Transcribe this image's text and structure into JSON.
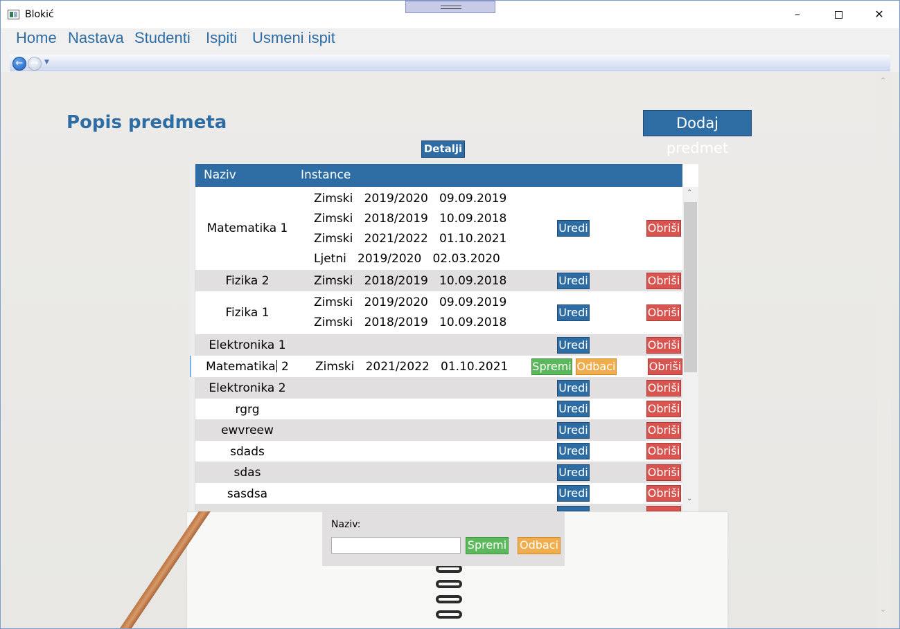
{
  "window": {
    "title": "Blokić"
  },
  "menu": [
    "Home",
    "Nastava",
    "Studenti",
    "Ispiti",
    "Usmeni ispit"
  ],
  "page": {
    "title": "Popis predmeta",
    "add_button": "Dodaj predmet",
    "details_button": "Detalji"
  },
  "table": {
    "headers": {
      "name": "Naziv",
      "instances": "Instance"
    },
    "edit_label": "Uredi",
    "delete_label": "Obriši",
    "save_label": "Spremi",
    "cancel_label": "Odbaci",
    "rows": [
      {
        "name": "Matematika 1",
        "instances": [
          "Zimski   2019/2020   09.09.2019",
          "Zimski   2018/2019   10.09.2018",
          "Zimski   2021/2022   01.10.2021",
          "Ljetni   2019/2020   02.03.2020"
        ]
      },
      {
        "name": "Fizika 2",
        "instances": [
          "Zimski   2018/2019   10.09.2018"
        ]
      },
      {
        "name": "Fizika 1",
        "instances": [
          "Zimski   2019/2020   09.09.2019",
          "Zimski   2018/2019   10.09.2018"
        ]
      },
      {
        "name": "Elektronika 1",
        "instances": []
      },
      {
        "name_before_caret": "Matematika",
        "name_after_caret": " 2",
        "instances": [
          "Zimski   2021/2022   01.10.2021"
        ],
        "editing": true
      },
      {
        "name": "Elektronika 2",
        "instances": []
      },
      {
        "name": "rgrg",
        "instances": []
      },
      {
        "name": "ewvreew",
        "instances": []
      },
      {
        "name": "sdads",
        "instances": []
      },
      {
        "name": "sdas",
        "instances": []
      },
      {
        "name": "sasdsa",
        "instances": []
      }
    ]
  },
  "form": {
    "label": "Naziv:",
    "value": "",
    "save_label": "Spremi",
    "cancel_label": "Odbaci"
  },
  "colors": {
    "primary": "#2e6da4",
    "danger": "#d9534f",
    "success": "#5cb85c",
    "warning": "#f0ad4e",
    "row_alt": "#e1dfdf"
  }
}
